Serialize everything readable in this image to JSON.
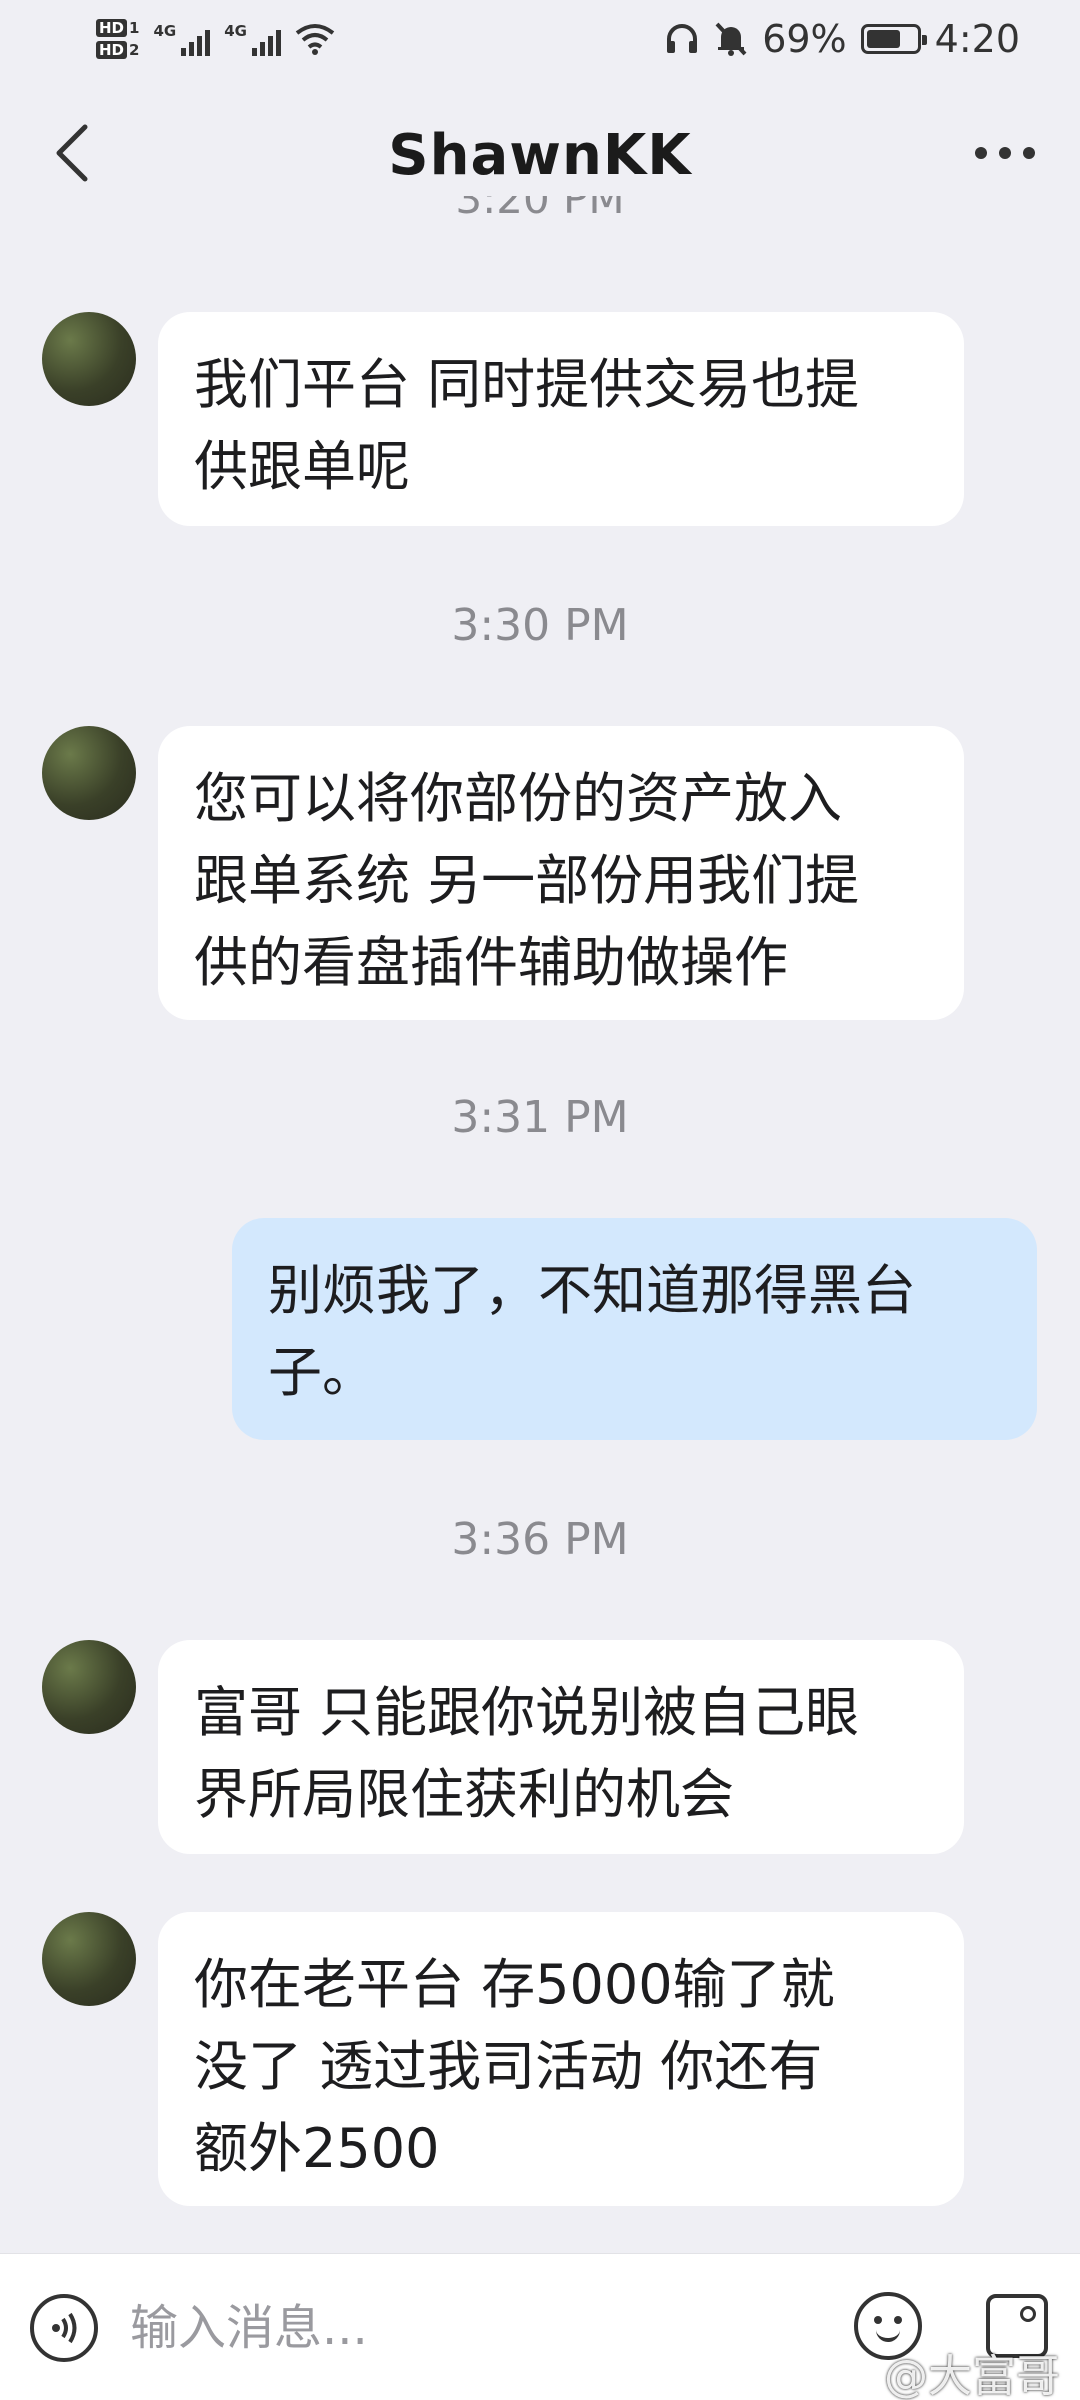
{
  "status_bar": {
    "sim1": "HD",
    "sim1_index": "1",
    "sim2": "HD",
    "sim2_index": "2",
    "network1": "4G",
    "network2": "4G",
    "icons": [
      "headphones-icon",
      "mute-bell-icon",
      "wifi-icon"
    ],
    "battery": "69%",
    "battery_level": 0.69,
    "time": "4:20"
  },
  "header": {
    "title": "ShawnKK",
    "back_icon": "chevron-left-icon",
    "more_icon": "more-horizontal-icon"
  },
  "partial_time": "3:20 PM",
  "messages": [
    {
      "side": "in",
      "lines": [
        "我们平台 同时提供交易也提",
        "供跟单呢"
      ]
    },
    {
      "time": "3:30 PM"
    },
    {
      "side": "in",
      "lines": [
        "您可以将你部份的资产放入",
        "跟单系统 另一部份用我们提",
        "供的看盘插件辅助做操作"
      ]
    },
    {
      "time": "3:31 PM"
    },
    {
      "side": "out",
      "lines": [
        "别烦我了，不知道那得黑台",
        "子。"
      ]
    },
    {
      "time": "3:36 PM"
    },
    {
      "side": "in",
      "lines": [
        "富哥 只能跟你说别被自己眼",
        "界所局限住获利的机会"
      ]
    },
    {
      "side": "in",
      "lines": [
        "你在老平台 存5000输了就",
        "没了 透过我司活动 你还有",
        "额外2500"
      ]
    }
  ],
  "input": {
    "placeholder": "输入消息...",
    "voice_icon": "voice-icon",
    "emoji_icon": "emoji-icon",
    "image_icon": "image-icon"
  },
  "watermark": "@大富哥",
  "colors": {
    "background": "#efeff4",
    "incoming_bubble": "#ffffff",
    "outgoing_bubble": "#d3e8fd",
    "timestamp": "#8a8a8f"
  }
}
